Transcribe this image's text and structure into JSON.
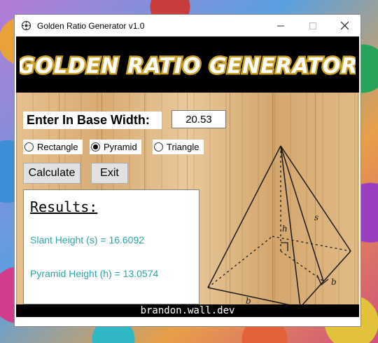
{
  "window": {
    "title": "Golden Ratio Generator v1.0",
    "minimize_icon": "minimize-icon",
    "maximize_icon": "maximize-icon",
    "close_icon": "close-icon"
  },
  "banner": {
    "text": "GOLDEN RATIO GENERATOR"
  },
  "form": {
    "base_width_label": "Enter In Base Width:",
    "base_width_value": "20.53",
    "shapes": [
      {
        "label": "Rectangle",
        "selected": false
      },
      {
        "label": "Pyramid",
        "selected": true
      },
      {
        "label": "Triangle",
        "selected": false
      }
    ],
    "calculate_label": "Calculate",
    "exit_label": "Exit"
  },
  "results": {
    "title": "Results:",
    "slant_height": "Slant Height (s) = 16.6092",
    "pyramid_height": "Pyramid Height (h) = 13.0574"
  },
  "diagram": {
    "label_s": "s",
    "label_h": "h",
    "label_b1": "b",
    "label_b2": "b"
  },
  "footer": {
    "text": "brandon.wall.dev"
  },
  "colors": {
    "result_text": "#2aa6a6",
    "banner_gold": "#e8c440"
  }
}
